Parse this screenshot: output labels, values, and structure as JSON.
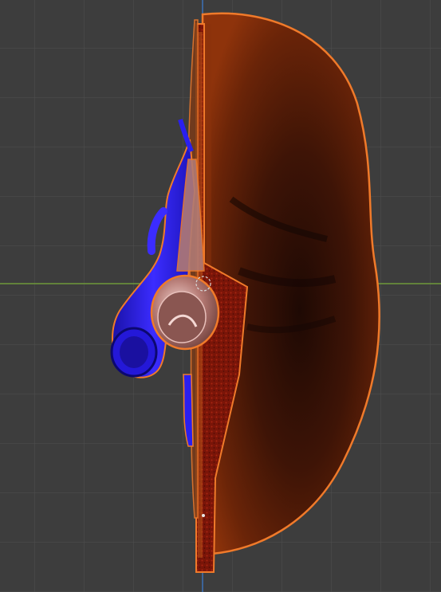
{
  "viewport": {
    "background_color": "#3d3d3d",
    "grid_color": "#4f4f4f",
    "x_axis_color": "#6f9a3a",
    "z_axis_color": "#3d72b8",
    "selection_outline_color": "#f07a2a"
  },
  "model": {
    "icon": "anatomical-organ-3d-model",
    "organ_colors": {
      "body_dark": "#2a0d05",
      "body_mid": "#5a1f08",
      "body_light": "#a8400d",
      "cut_surface": "#7a1508",
      "vessel_blue": "#2a1ff0",
      "vessel_pink": "#c88a84"
    }
  }
}
